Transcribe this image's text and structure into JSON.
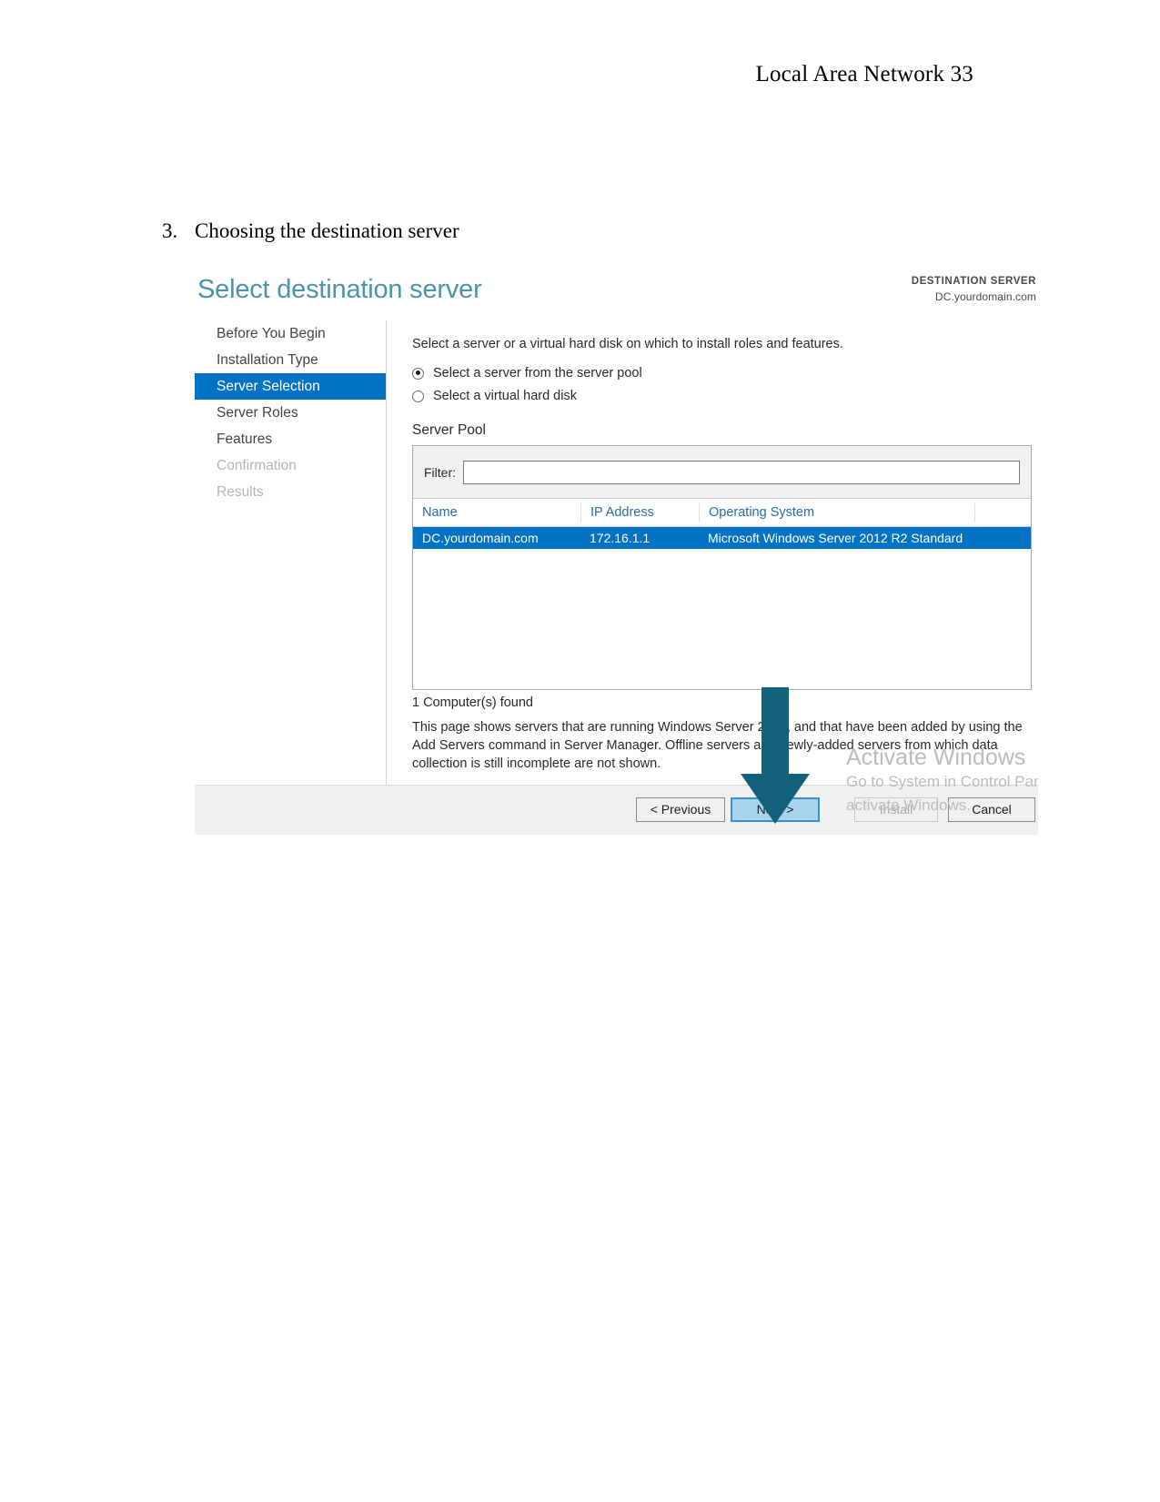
{
  "document": {
    "running_header": "Local Area Network 33",
    "step_number": "3.",
    "step_text": "Choosing the destination server"
  },
  "wizard": {
    "title": "Select destination server",
    "destination": {
      "label": "DESTINATION SERVER",
      "value": "DC.yourdomain.com"
    },
    "nav": {
      "items": [
        {
          "label": "Before You Begin",
          "state": "normal"
        },
        {
          "label": "Installation Type",
          "state": "normal"
        },
        {
          "label": "Server Selection",
          "state": "selected"
        },
        {
          "label": "Server Roles",
          "state": "normal"
        },
        {
          "label": "Features",
          "state": "normal"
        },
        {
          "label": "Confirmation",
          "state": "disabled"
        },
        {
          "label": "Results",
          "state": "disabled"
        }
      ]
    },
    "content": {
      "lead_text": "Select a server or a virtual hard disk on which to install roles and features.",
      "radio_pool": {
        "label": "Select a server from the server pool",
        "selected": true
      },
      "radio_vhd": {
        "label": "Select a virtual hard disk",
        "selected": false
      },
      "pool_label": "Server Pool",
      "filter_label": "Filter:",
      "filter_value": "",
      "filter_placeholder": "",
      "columns": [
        "Name",
        "IP Address",
        "Operating System"
      ],
      "rows": [
        {
          "name": "DC.yourdomain.com",
          "ip": "172.16.1.1",
          "os": "Microsoft Windows Server 2012 R2 Standard",
          "selected": true
        }
      ],
      "found_text": "1 Computer(s) found",
      "note_text": "This page shows servers that are running Windows Server 2012, and that have been added by using the Add Servers command in Server Manager. Offline servers and newly-added servers from which data collection is still incomplete are not shown."
    },
    "footer": {
      "previous": "< Previous",
      "next": "Next >",
      "install": "Install",
      "cancel": "Cancel"
    },
    "watermark": {
      "title": "Activate Windows",
      "line1": "Go to System in Control Panel to",
      "line2": "activate Windows."
    }
  },
  "colors": {
    "accent_blue": "#0272c4",
    "title_teal": "#4f93a8",
    "arrow_teal": "#13607c",
    "header_link": "#2b6ca8"
  }
}
